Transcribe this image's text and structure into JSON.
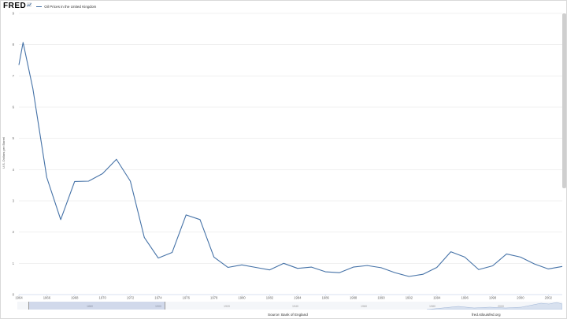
{
  "header": {
    "logo_text": "FRED",
    "legend_label": "Oil Prices in the United Kingdom"
  },
  "footer": {
    "source": "Source: Bank of England",
    "url": "fred.stlouisfed.org"
  },
  "navigator": {
    "labels": [
      "1880",
      "1900",
      "1920",
      "1940",
      "1960",
      "1980",
      "2000"
    ]
  },
  "colors": {
    "series": "#4572a7",
    "grid": "#e6e6e6",
    "axis_text": "#666666"
  },
  "chart_data": {
    "type": "line",
    "title": "",
    "xlabel": "",
    "ylabel": "U.S. Dollars per Barrel",
    "xlim": [
      1964,
      2003
    ],
    "ylim": [
      0,
      9
    ],
    "grid": true,
    "x_ticks": [
      "1964",
      "1966",
      "1968",
      "1970",
      "1972",
      "1974",
      "1976",
      "1978",
      "1980",
      "1982",
      "1984",
      "1986",
      "1988",
      "1990",
      "1992",
      "1994",
      "1996",
      "1998",
      "2000",
      "2002"
    ],
    "y_ticks": [
      "0",
      "1",
      "2",
      "3",
      "4",
      "5",
      "6",
      "7",
      "8",
      "9"
    ],
    "series": [
      {
        "name": "Oil Prices in the United Kingdom",
        "x": [
          1964,
          1964.3,
          1965,
          1966,
          1967,
          1968,
          1969,
          1970,
          1971,
          1972,
          1973,
          1974,
          1975,
          1976,
          1977,
          1978,
          1979,
          1980,
          1981,
          1982,
          1983,
          1984,
          1985,
          1986,
          1987,
          1988,
          1989,
          1990,
          1991,
          1992,
          1993,
          1994,
          1995,
          1996,
          1997,
          1998,
          1999,
          2000,
          2001,
          2002,
          2003
        ],
        "values": [
          7.35,
          8.07,
          6.6,
          3.75,
          2.4,
          3.62,
          3.63,
          3.87,
          4.33,
          3.63,
          1.83,
          1.17,
          1.35,
          2.55,
          2.4,
          1.2,
          0.87,
          0.95,
          0.87,
          0.79,
          1.0,
          0.84,
          0.88,
          0.73,
          0.7,
          0.88,
          0.93,
          0.86,
          0.7,
          0.58,
          0.65,
          0.87,
          1.37,
          1.2,
          0.8,
          0.92,
          1.3,
          1.2,
          0.98,
          0.82,
          0.9
        ]
      }
    ]
  }
}
